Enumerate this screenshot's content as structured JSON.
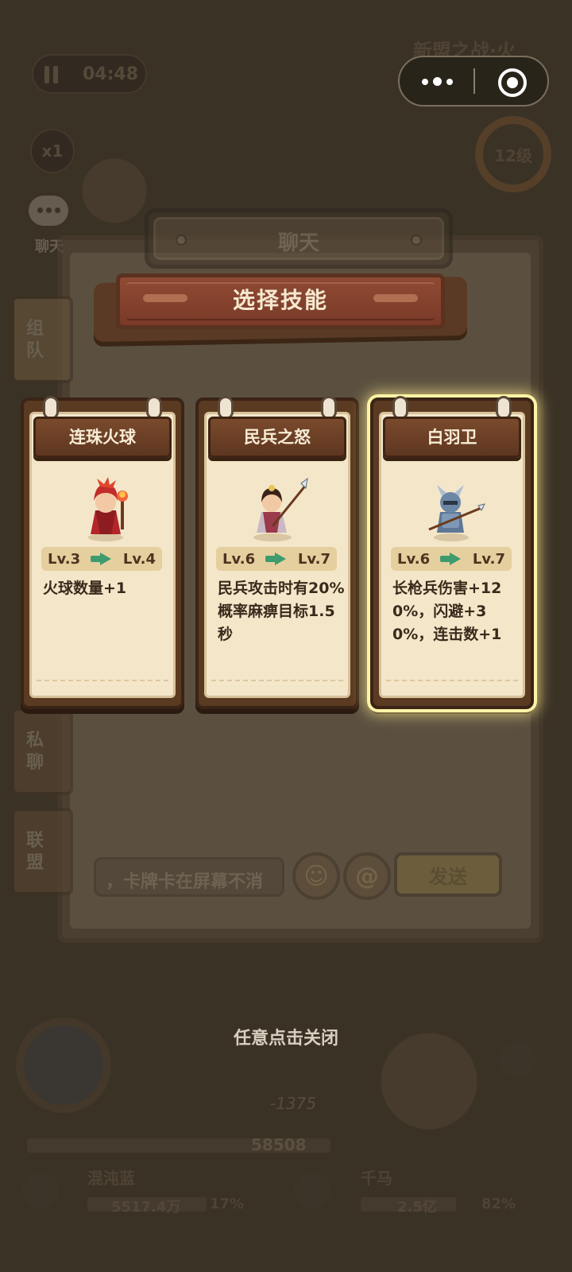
{
  "hud": {
    "timer": "04:48",
    "speed": "x1",
    "stage_title": "新盟之战·火",
    "level": "12级",
    "chat_icon_label": "聊天"
  },
  "chat": {
    "title": "聊天",
    "tabs": [
      "组队",
      "私聊",
      "联盟"
    ],
    "input_placeholder": "，卡牌卡在屏幕不消",
    "emoji_label": "☺",
    "at_label": "@",
    "send_label": "发送"
  },
  "skill_select": {
    "title": "选择技能",
    "cards": [
      {
        "name": "连珠火球",
        "level_from": "Lv.3",
        "level_to": "Lv.4",
        "description": "火球数量+1",
        "highlighted": false,
        "portrait": "red-mage-icon"
      },
      {
        "name": "民兵之怒",
        "level_from": "Lv.6",
        "level_to": "Lv.7",
        "description": "民兵攻击时有20%概率麻痹目标1.5秒",
        "highlighted": false,
        "portrait": "militia-spear-icon"
      },
      {
        "name": "白羽卫",
        "level_from": "Lv.6",
        "level_to": "Lv.7",
        "description": "长枪兵伤害+120%，闪避+30%，连击数+1",
        "highlighted": true,
        "portrait": "armored-spearman-icon"
      }
    ],
    "close_hint": "任意点击关闭"
  },
  "battle": {
    "damage": "-1375",
    "hp": "58508",
    "players": [
      {
        "name": "混沌蓝",
        "power": "5517.4万",
        "percent": "17%"
      },
      {
        "name": "千马",
        "power": "2.5亿",
        "percent": "82%"
      }
    ]
  },
  "colors": {
    "card_glow": "#fff3a6",
    "banner_red": "#8f4a33",
    "paper": "#f4e6c9",
    "level_arrow": "#3e9b6e"
  }
}
